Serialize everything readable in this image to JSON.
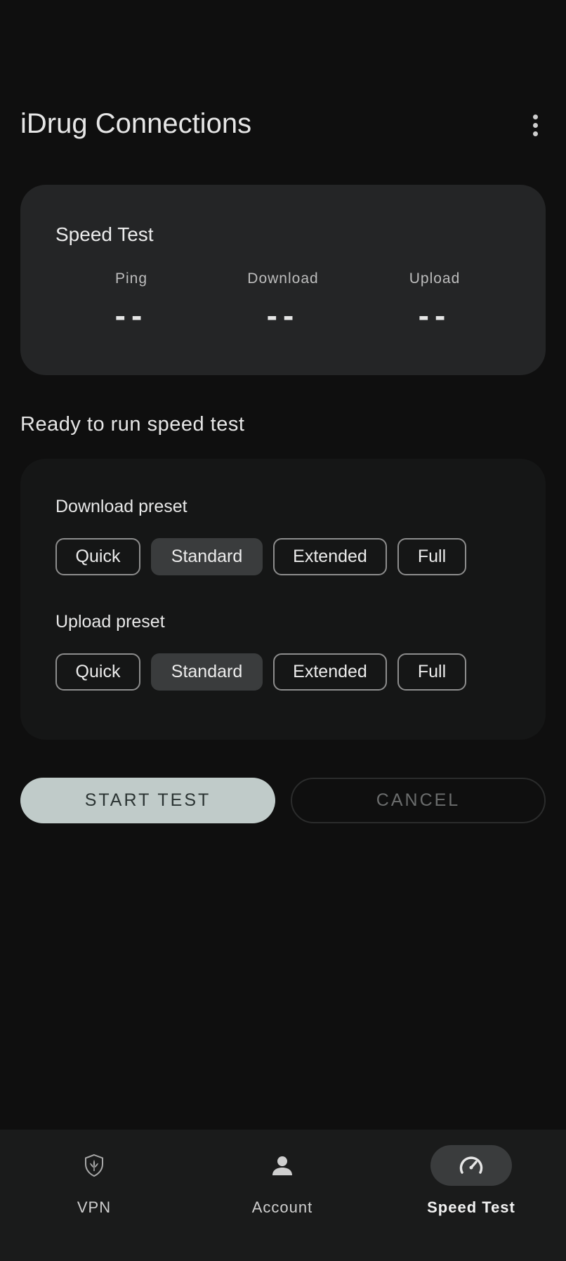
{
  "header": {
    "title": "iDrug Connections",
    "more_icon": "more-vert-icon"
  },
  "speed_card": {
    "title": "Speed Test",
    "metrics": [
      {
        "label": "Ping",
        "value": "--"
      },
      {
        "label": "Download",
        "value": "--"
      },
      {
        "label": "Upload",
        "value": "--"
      }
    ]
  },
  "status": "Ready to run speed test",
  "presets": {
    "download": {
      "label": "Download preset",
      "options": [
        "Quick",
        "Standard",
        "Extended",
        "Full"
      ],
      "selected": "Standard"
    },
    "upload": {
      "label": "Upload preset",
      "options": [
        "Quick",
        "Standard",
        "Extended",
        "Full"
      ],
      "selected": "Standard"
    }
  },
  "actions": {
    "start_label": "START TEST",
    "cancel_label": "CANCEL"
  },
  "bottom_nav": {
    "items": [
      {
        "label": "VPN",
        "icon": "shield-leaf-icon",
        "active": false
      },
      {
        "label": "Account",
        "icon": "person-icon",
        "active": false
      },
      {
        "label": "Speed Test",
        "icon": "speedometer-icon",
        "active": true
      }
    ]
  },
  "colors": {
    "background": "#0f0f0f",
    "card": "#242526",
    "preset_card": "#151616",
    "selected_chip": "#3a3c3d",
    "start_button": "#c0cbc9",
    "nav_bar": "#1a1b1b"
  }
}
